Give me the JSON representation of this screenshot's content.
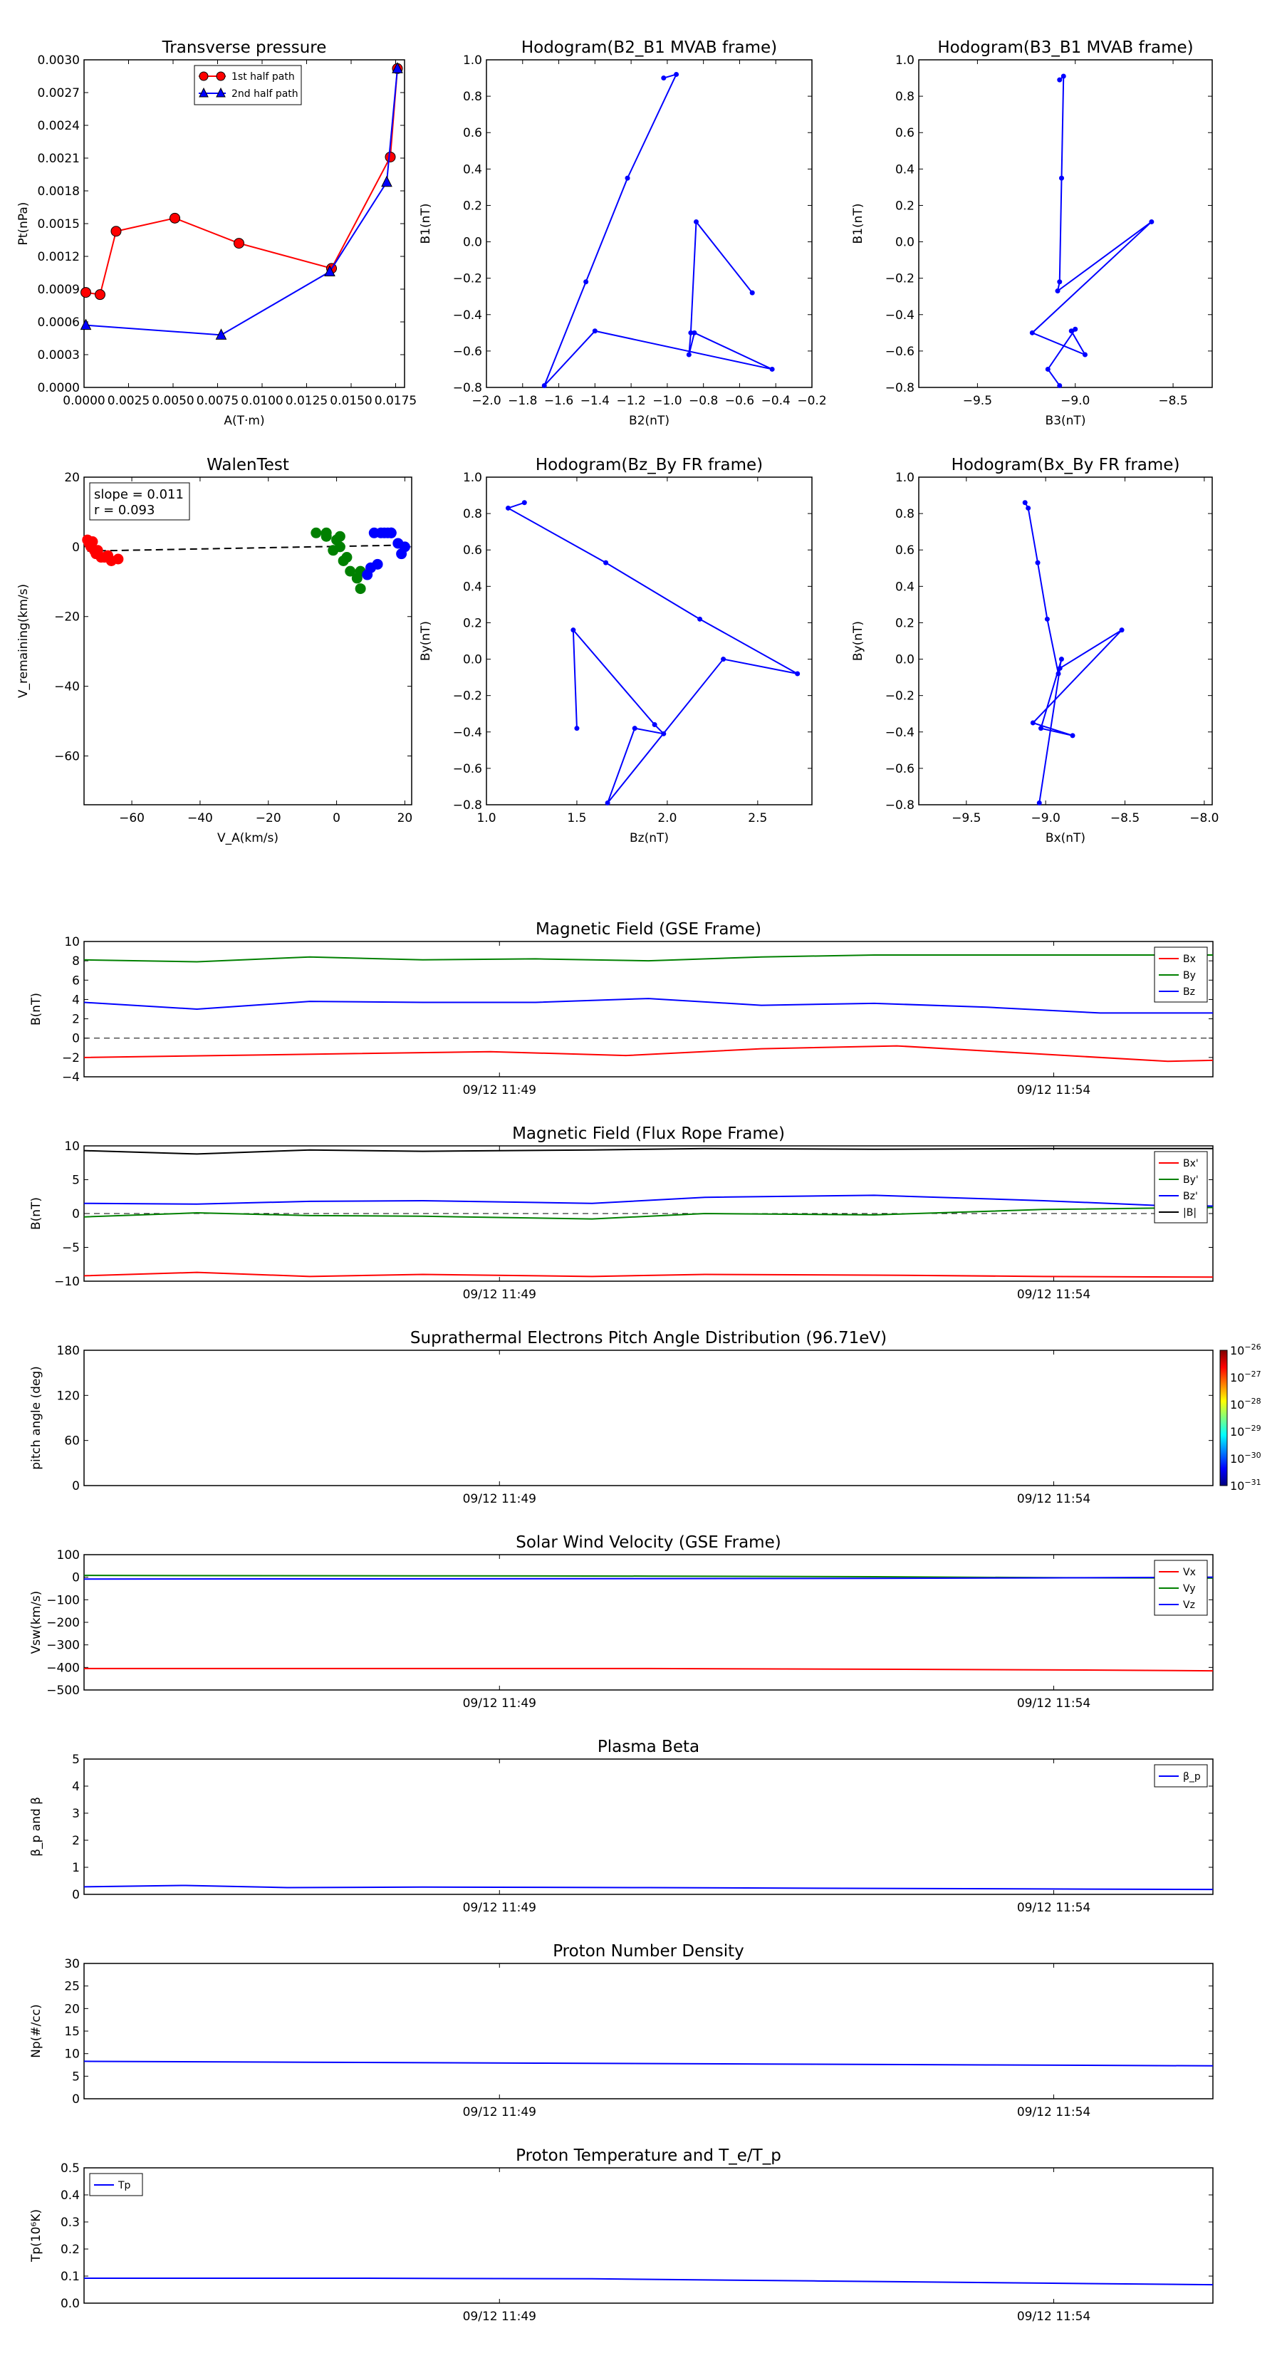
{
  "chart_data": [
    {
      "id": "tp",
      "type": "line",
      "title": "Transverse pressure",
      "xlabel": "A(T·m)",
      "ylabel": "Pt(nPa)",
      "xlim": [
        0,
        0.018
      ],
      "ylim": [
        0,
        0.003
      ],
      "xticks": [
        0,
        0.0025,
        0.005,
        0.0075,
        0.01,
        0.0125,
        0.015,
        0.0175
      ],
      "xtick_labels": [
        "0.0000",
        "0.0025",
        "0.0050",
        "0.0075",
        "0.0100",
        "0.0125",
        "0.0150",
        "0.0175"
      ],
      "yticks": [
        0,
        0.0003,
        0.0006,
        0.0009,
        0.0012,
        0.0015,
        0.0018,
        0.0021,
        0.0024,
        0.0027,
        0.003
      ],
      "ytick_labels": [
        "0.0000",
        "0.0003",
        "0.0006",
        "0.0009",
        "0.0012",
        "0.0015",
        "0.0018",
        "0.0021",
        "0.0024",
        "0.0027",
        "0.0030"
      ],
      "legend": "top-center",
      "series": [
        {
          "name": "1st half path",
          "color": "#ff0000",
          "marker": "circle",
          "x": [
            0.0176,
            0.0172,
            0.0139,
            0.0087,
            0.0051,
            0.0018,
            0.0009,
            0.0001
          ],
          "y": [
            0.00292,
            0.00211,
            0.00109,
            0.00132,
            0.00155,
            0.00143,
            0.00085,
            0.00087
          ]
        },
        {
          "name": "2nd half path",
          "color": "#0000ff",
          "marker": "triangle",
          "x": [
            0.0176,
            0.017,
            0.0138,
            0.0077,
            0.0001
          ],
          "y": [
            0.00292,
            0.00188,
            0.00106,
            0.00048,
            0.00057
          ]
        }
      ]
    },
    {
      "id": "h1",
      "type": "line",
      "title": "Hodogram(B2_B1 MVAB frame)",
      "xlabel": "B2(nT)",
      "ylabel": "B1(nT)",
      "xlim": [
        -2.0,
        -0.2
      ],
      "ylim": [
        -0.8,
        1.0
      ],
      "xticks": [
        -2.0,
        -1.8,
        -1.6,
        -1.4,
        -1.2,
        -1.0,
        -0.8,
        -0.6,
        -0.4,
        -0.2
      ],
      "xtick_labels": [
        "−2.0",
        "−1.8",
        "−1.6",
        "−1.4",
        "−1.2",
        "−1.0",
        "−0.8",
        "−0.6",
        "−0.4",
        "−0.2"
      ],
      "yticks": [
        -0.8,
        -0.6,
        -0.4,
        -0.2,
        0,
        0.2,
        0.4,
        0.6,
        0.8,
        1.0
      ],
      "ytick_labels": [
        "−0.8",
        "−0.6",
        "−0.4",
        "−0.2",
        "0.0",
        "0.2",
        "0.4",
        "0.6",
        "0.8",
        "1.0"
      ],
      "series": [
        {
          "color": "#0000ff",
          "x": [
            -1.02,
            -0.95,
            -1.22,
            -1.45,
            -1.68,
            -1.4,
            -0.42,
            -0.85,
            -0.88,
            -0.87,
            -0.84,
            -0.53
          ],
          "y": [
            0.9,
            0.92,
            0.35,
            -0.22,
            -0.79,
            -0.49,
            -0.7,
            -0.5,
            -0.62,
            -0.5,
            0.11,
            -0.28
          ]
        }
      ]
    },
    {
      "id": "h2",
      "type": "line",
      "title": "Hodogram(B3_B1 MVAB frame)",
      "xlabel": "B3(nT)",
      "ylabel": "B1(nT)",
      "xlim": [
        -9.8,
        -8.3
      ],
      "ylim": [
        -0.8,
        1.0
      ],
      "xticks": [
        -9.5,
        -9.0,
        -8.5
      ],
      "xtick_labels": [
        "−9.5",
        "−9.0",
        "−8.5"
      ],
      "yticks": [
        -0.8,
        -0.6,
        -0.4,
        -0.2,
        0,
        0.2,
        0.4,
        0.6,
        0.8,
        1.0
      ],
      "ytick_labels": [
        "−0.8",
        "−0.6",
        "−0.4",
        "−0.2",
        "0.0",
        "0.2",
        "0.4",
        "0.6",
        "0.8",
        "1.0"
      ],
      "series": [
        {
          "color": "#0000ff",
          "x": [
            -9.08,
            -9.06,
            -9.07,
            -9.08,
            -9.09,
            -8.61,
            -9.22,
            -8.95,
            -9.02,
            -9.0,
            -9.14,
            -9.08
          ],
          "y": [
            0.89,
            0.91,
            0.35,
            -0.22,
            -0.27,
            0.11,
            -0.5,
            -0.62,
            -0.49,
            -0.48,
            -0.7,
            -0.79
          ]
        }
      ]
    },
    {
      "id": "walen",
      "type": "scatter",
      "title": "WalenTest",
      "xlabel": "V_A(km/s)",
      "ylabel": "V_remaining(km/s)",
      "xlim": [
        -74,
        22
      ],
      "ylim": [
        -74,
        20
      ],
      "xticks": [
        -60,
        -40,
        -20,
        0,
        20
      ],
      "xtick_labels": [
        "−60",
        "−40",
        "−20",
        "0",
        "20"
      ],
      "yticks": [
        -60,
        -40,
        -20,
        0,
        20
      ],
      "ytick_labels": [
        "−60",
        "−40",
        "−20",
        "0",
        "20"
      ],
      "annotation_lines": [
        "slope = 0.011",
        "r = 0.093"
      ],
      "fit_line": {
        "x": [
          -73,
          20
        ],
        "y": [
          -1.2,
          0.5
        ]
      },
      "series": [
        {
          "color": "#ff0000",
          "x": [
            -73,
            -72.5,
            -72,
            -71.5,
            -71,
            -70.5,
            -70,
            -69,
            -68,
            -67,
            -66,
            -64
          ],
          "y": [
            2,
            1,
            0,
            1.5,
            -1,
            -2,
            -1,
            -3,
            -3,
            -2.5,
            -4,
            -3.5
          ]
        },
        {
          "color": "#008000",
          "x": [
            -6,
            -3,
            -3,
            -1,
            0,
            1,
            1,
            2,
            3,
            4,
            6,
            7,
            7
          ],
          "y": [
            4,
            4,
            3,
            -1,
            2,
            3,
            0,
            -4,
            -3,
            -7,
            -9,
            -12,
            -7
          ]
        },
        {
          "color": "#0000ff",
          "x": [
            9,
            10,
            11,
            12,
            13,
            14,
            15,
            16,
            16,
            18,
            19,
            20
          ],
          "y": [
            -8,
            -6,
            4,
            -5,
            4,
            4,
            4,
            4,
            4,
            1,
            -2,
            0
          ]
        }
      ]
    },
    {
      "id": "h3",
      "type": "line",
      "title": "Hodogram(Bz_By FR frame)",
      "xlabel": "Bz(nT)",
      "ylabel": "By(nT)",
      "xlim": [
        1.0,
        2.8
      ],
      "ylim": [
        -0.8,
        1.0
      ],
      "xticks": [
        1.0,
        1.5,
        2.0,
        2.5
      ],
      "xtick_labels": [
        "1.0",
        "1.5",
        "2.0",
        "2.5"
      ],
      "yticks": [
        -0.8,
        -0.6,
        -0.4,
        -0.2,
        0,
        0.2,
        0.4,
        0.6,
        0.8,
        1.0
      ],
      "ytick_labels": [
        "−0.8",
        "−0.6",
        "−0.4",
        "−0.2",
        "0.0",
        "0.2",
        "0.4",
        "0.6",
        "0.8",
        "1.0"
      ],
      "series": [
        {
          "color": "#0000ff",
          "x": [
            1.21,
            1.12,
            1.66,
            2.18,
            2.72,
            2.31,
            1.67,
            1.82,
            1.98,
            1.93,
            1.48,
            1.5
          ],
          "y": [
            0.86,
            0.83,
            0.53,
            0.22,
            -0.08,
            0.0,
            -0.79,
            -0.38,
            -0.41,
            -0.36,
            0.16,
            -0.38
          ]
        }
      ]
    },
    {
      "id": "h4",
      "type": "line",
      "title": "Hodogram(Bx_By FR frame)",
      "xlabel": "Bx(nT)",
      "ylabel": "By(nT)",
      "xlim": [
        -9.8,
        -7.95
      ],
      "ylim": [
        -0.8,
        1.0
      ],
      "xticks": [
        -9.5,
        -9.0,
        -8.5,
        -8.0
      ],
      "xtick_labels": [
        "−9.5",
        "−9.0",
        "−8.5",
        "−8.0"
      ],
      "yticks": [
        -0.8,
        -0.6,
        -0.4,
        -0.2,
        0,
        0.2,
        0.4,
        0.6,
        0.8,
        1.0
      ],
      "ytick_labels": [
        "−0.8",
        "−0.6",
        "−0.4",
        "−0.2",
        "0.0",
        "0.2",
        "0.4",
        "0.6",
        "0.8",
        "1.0"
      ],
      "series": [
        {
          "color": "#0000ff",
          "x": [
            -9.13,
            -9.11,
            -9.05,
            -8.99,
            -8.92,
            -8.9,
            -9.03,
            -8.83,
            -9.08,
            -8.52,
            -8.91,
            -9.04
          ],
          "y": [
            0.86,
            0.83,
            0.53,
            0.22,
            -0.08,
            0.0,
            -0.38,
            -0.42,
            -0.35,
            0.16,
            -0.05,
            -0.79
          ]
        }
      ]
    },
    {
      "id": "ts1",
      "type": "line",
      "title": "Magnetic Field (GSE Frame)",
      "ylabel": "B(nT)",
      "ylim": [
        -4,
        10
      ],
      "yticks": [
        -4,
        -2,
        0,
        2,
        4,
        6,
        8,
        10
      ],
      "ytick_labels": [
        "−4",
        "−2",
        "0",
        "2",
        "4",
        "6",
        "8",
        "10"
      ],
      "xticks": [
        0.368,
        0.859
      ],
      "xtick_labels": [
        "09/12 11:49",
        "09/12 11:54"
      ],
      "zero_line": true,
      "legend": "top-right",
      "series": [
        {
          "name": "Bx",
          "color": "#ff0000",
          "t": [
            0,
            0.12,
            0.24,
            0.36,
            0.48,
            0.6,
            0.72,
            0.84,
            0.96,
            1.0
          ],
          "values": [
            -2.0,
            -1.8,
            -1.6,
            -1.4,
            -1.8,
            -1.1,
            -0.8,
            -1.6,
            -2.4,
            -2.3
          ]
        },
        {
          "name": "By",
          "color": "#008000",
          "t": [
            0,
            0.1,
            0.2,
            0.3,
            0.4,
            0.5,
            0.6,
            0.7,
            0.8,
            0.9,
            1.0
          ],
          "values": [
            8.1,
            7.9,
            8.4,
            8.1,
            8.2,
            8.0,
            8.4,
            8.6,
            8.6,
            8.6,
            8.6
          ]
        },
        {
          "name": "Bz",
          "color": "#0000ff",
          "t": [
            0,
            0.1,
            0.2,
            0.3,
            0.4,
            0.5,
            0.6,
            0.7,
            0.8,
            0.9,
            1.0
          ],
          "values": [
            3.7,
            3.0,
            3.8,
            3.7,
            3.7,
            4.1,
            3.4,
            3.6,
            3.2,
            2.6,
            2.6
          ]
        }
      ]
    },
    {
      "id": "ts2",
      "type": "line",
      "title": "Magnetic Field (Flux Rope Frame)",
      "ylabel": "B(nT)",
      "ylim": [
        -10,
        10
      ],
      "yticks": [
        -10,
        -5,
        0,
        5,
        10
      ],
      "ytick_labels": [
        "−10",
        "−5",
        "0",
        "5",
        "10"
      ],
      "xticks": [
        0.368,
        0.859
      ],
      "xtick_labels": [
        "09/12 11:49",
        "09/12 11:54"
      ],
      "zero_line": true,
      "legend": "top-right",
      "series": [
        {
          "name": "Bx'",
          "color": "#ff0000",
          "t": [
            0,
            0.1,
            0.2,
            0.3,
            0.45,
            0.55,
            0.7,
            0.85,
            1.0
          ],
          "values": [
            -9.2,
            -8.7,
            -9.3,
            -9.0,
            -9.3,
            -9.0,
            -9.1,
            -9.3,
            -9.4
          ]
        },
        {
          "name": "By'",
          "color": "#008000",
          "t": [
            0,
            0.1,
            0.2,
            0.3,
            0.45,
            0.55,
            0.7,
            0.85,
            1.0
          ],
          "values": [
            -0.5,
            0.1,
            -0.3,
            -0.4,
            -0.8,
            0.0,
            -0.2,
            0.6,
            0.9
          ]
        },
        {
          "name": "Bz'",
          "color": "#0000ff",
          "t": [
            0,
            0.1,
            0.2,
            0.3,
            0.45,
            0.55,
            0.7,
            0.85,
            0.95,
            1.0
          ],
          "values": [
            1.5,
            1.4,
            1.8,
            1.9,
            1.5,
            2.4,
            2.7,
            1.9,
            1.2,
            1.1
          ]
        },
        {
          "name": "|B|",
          "color": "#000000",
          "t": [
            0,
            0.1,
            0.2,
            0.3,
            0.45,
            0.55,
            0.7,
            0.85,
            1.0
          ],
          "values": [
            9.3,
            8.8,
            9.4,
            9.2,
            9.4,
            9.6,
            9.5,
            9.6,
            9.6
          ]
        }
      ]
    },
    {
      "id": "ts3",
      "type": "heatmap",
      "title": "Suprathermal Electrons Pitch Angle Distribution (96.71eV)",
      "ylabel": "pitch angle (deg)",
      "ylim": [
        0,
        180
      ],
      "yticks": [
        0,
        60,
        120,
        180
      ],
      "ytick_labels": [
        "0",
        "60",
        "120",
        "180"
      ],
      "xticks": [
        0.368,
        0.859
      ],
      "xtick_labels": [
        "09/12 11:49",
        "09/12 11:54"
      ],
      "colorbar": {
        "range": [
          -31,
          -26
        ],
        "tick_exponents": [
          "-26",
          "-27",
          "-28",
          "-29",
          "-30",
          "-31"
        ]
      }
    },
    {
      "id": "ts4",
      "type": "line",
      "title": "Solar Wind Velocity (GSE Frame)",
      "ylabel": "Vsw(km/s)",
      "ylim": [
        -500,
        100
      ],
      "yticks": [
        -500,
        -400,
        -300,
        -200,
        -100,
        0,
        100
      ],
      "ytick_labels": [
        "−500",
        "−400",
        "−300",
        "−200",
        "−100",
        "0",
        "100"
      ],
      "xticks": [
        0.368,
        0.859
      ],
      "xtick_labels": [
        "09/12 11:49",
        "09/12 11:54"
      ],
      "legend": "top-right",
      "series": [
        {
          "name": "Vx",
          "color": "#ff0000",
          "t": [
            0,
            0.3,
            0.5,
            0.7,
            0.9,
            1.0
          ],
          "values": [
            -405,
            -405,
            -405,
            -408,
            -412,
            -415
          ]
        },
        {
          "name": "Vy",
          "color": "#008000",
          "t": [
            0,
            0.3,
            0.5,
            0.7,
            0.85,
            1.0
          ],
          "values": [
            8,
            6,
            5,
            2,
            -2,
            -4
          ]
        },
        {
          "name": "Vz",
          "color": "#0000ff",
          "t": [
            0,
            0.3,
            0.5,
            0.7,
            0.85,
            1.0
          ],
          "values": [
            -8,
            -7,
            -6,
            -5,
            -3,
            0
          ]
        }
      ]
    },
    {
      "id": "ts5",
      "type": "line",
      "title": "Plasma Beta",
      "ylabel": "β_p and β",
      "ylim": [
        0,
        5
      ],
      "yticks": [
        0,
        1,
        2,
        3,
        4,
        5
      ],
      "ytick_labels": [
        "0",
        "1",
        "2",
        "3",
        "4",
        "5"
      ],
      "xticks": [
        0.368,
        0.859
      ],
      "xtick_labels": [
        "09/12 11:49",
        "09/12 11:54"
      ],
      "legend": "top-right",
      "series": [
        {
          "name": "β_p",
          "color": "#0000ff",
          "t": [
            0,
            0.09,
            0.18,
            0.3,
            0.5,
            0.7,
            0.85,
            1.0
          ],
          "values": [
            0.28,
            0.33,
            0.25,
            0.27,
            0.25,
            0.22,
            0.2,
            0.18
          ]
        }
      ]
    },
    {
      "id": "ts6",
      "type": "line",
      "title": "Proton Number Density",
      "ylabel": "Np(#/cc)",
      "ylim": [
        0,
        30
      ],
      "yticks": [
        0,
        5,
        10,
        15,
        20,
        25,
        30
      ],
      "ytick_labels": [
        "0",
        "5",
        "10",
        "15",
        "20",
        "25",
        "30"
      ],
      "xticks": [
        0.368,
        0.859
      ],
      "xtick_labels": [
        "09/12 11:49",
        "09/12 11:54"
      ],
      "series": [
        {
          "name": "Np",
          "color": "#0000ff",
          "t": [
            0,
            0.2,
            0.4,
            0.6,
            0.8,
            1.0
          ],
          "values": [
            8.3,
            8.1,
            7.9,
            7.7,
            7.5,
            7.3
          ]
        }
      ]
    },
    {
      "id": "ts7",
      "type": "line",
      "title": "Proton Temperature and T_e/T_p",
      "ylabel": "Tp(10⁶K)",
      "ylim": [
        0,
        0.5
      ],
      "yticks": [
        0,
        0.1,
        0.2,
        0.3,
        0.4,
        0.5
      ],
      "ytick_labels": [
        "0.0",
        "0.1",
        "0.2",
        "0.3",
        "0.4",
        "0.5"
      ],
      "xticks": [
        0.368,
        0.859
      ],
      "xtick_labels": [
        "09/12 11:49",
        "09/12 11:54"
      ],
      "legend": "top-left",
      "series": [
        {
          "name": "Tp",
          "color": "#0000ff",
          "t": [
            0,
            0.25,
            0.45,
            0.65,
            0.85,
            1.0
          ],
          "values": [
            0.092,
            0.092,
            0.09,
            0.082,
            0.074,
            0.068
          ]
        }
      ]
    }
  ]
}
